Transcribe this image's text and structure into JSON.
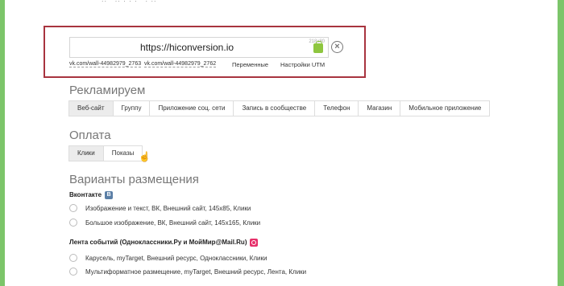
{
  "url_block": {
    "url": "https://hiconversion.io",
    "image_size": "218x80",
    "links": [
      "vk.com/wall-44982979_2763",
      "vk.com/wall-44982979_2762"
    ],
    "variables_label": "Переменные",
    "utm_label": "Настройки UTM"
  },
  "advertise": {
    "title": "Рекламируем",
    "options": [
      "Веб-сайт",
      "Группу",
      "Приложение соц. сети",
      "Запись в сообществе",
      "Телефон",
      "Магазин",
      "Мобильное приложение"
    ],
    "selected": "Веб-сайт"
  },
  "payment": {
    "title": "Оплата",
    "options": [
      "Клики",
      "Показы"
    ],
    "selected": "Клики"
  },
  "placements": {
    "title": "Варианты размещения",
    "vk": {
      "heading": "Вконтакте",
      "badge": "B",
      "items": [
        "Изображение и текст, ВК, Внешний сайт, 145x85, Клики",
        "Большое изображение, ВК, Внешний сайт, 145x165, Клики"
      ]
    },
    "mail": {
      "heading": "Лента событий (Одноклассники.Ру и МойМир@Mail.Ru)",
      "items": [
        "Карусель, myTarget, Внешний ресурс, Одноклассники, Клики",
        "Мультиформатное размещение, myTarget, Внешний ресурс, Лента, Клики"
      ]
    }
  },
  "colors": {
    "frame": "#7cc56a",
    "highlight": "#a8343f",
    "cart_icon": "#8ec63f"
  }
}
